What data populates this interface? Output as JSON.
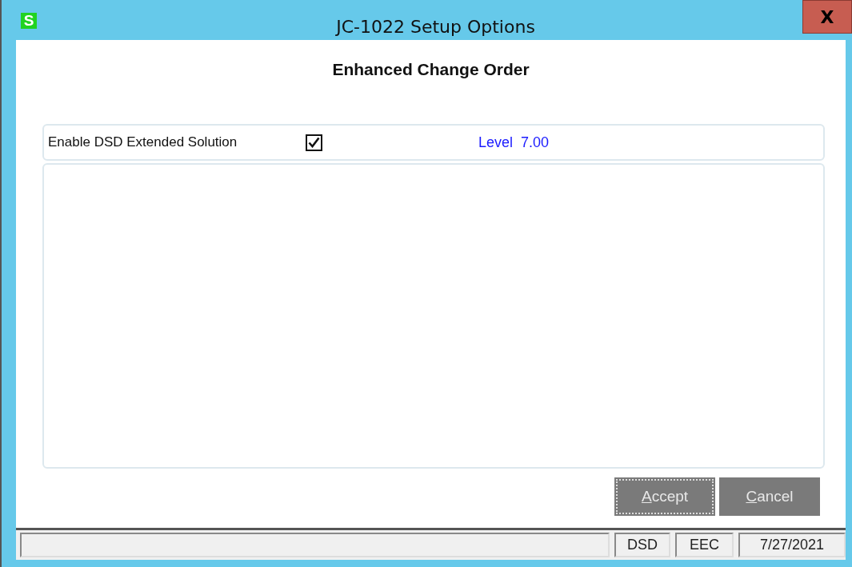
{
  "window": {
    "title": "JC-1022 Setup Options",
    "close": "X",
    "app_icon": "S"
  },
  "heading": "Enhanced Change Order",
  "option": {
    "label": "Enable DSD Extended Solution",
    "checked": true,
    "level_text": "Level  7.00"
  },
  "buttons": [
    {
      "access_key": "A",
      "rest": "ccept",
      "focused": true
    },
    {
      "access_key": "C",
      "rest": "ancel",
      "focused": false
    }
  ],
  "status_bar": [
    "DSD",
    "EEC",
    "7/27/2021"
  ]
}
